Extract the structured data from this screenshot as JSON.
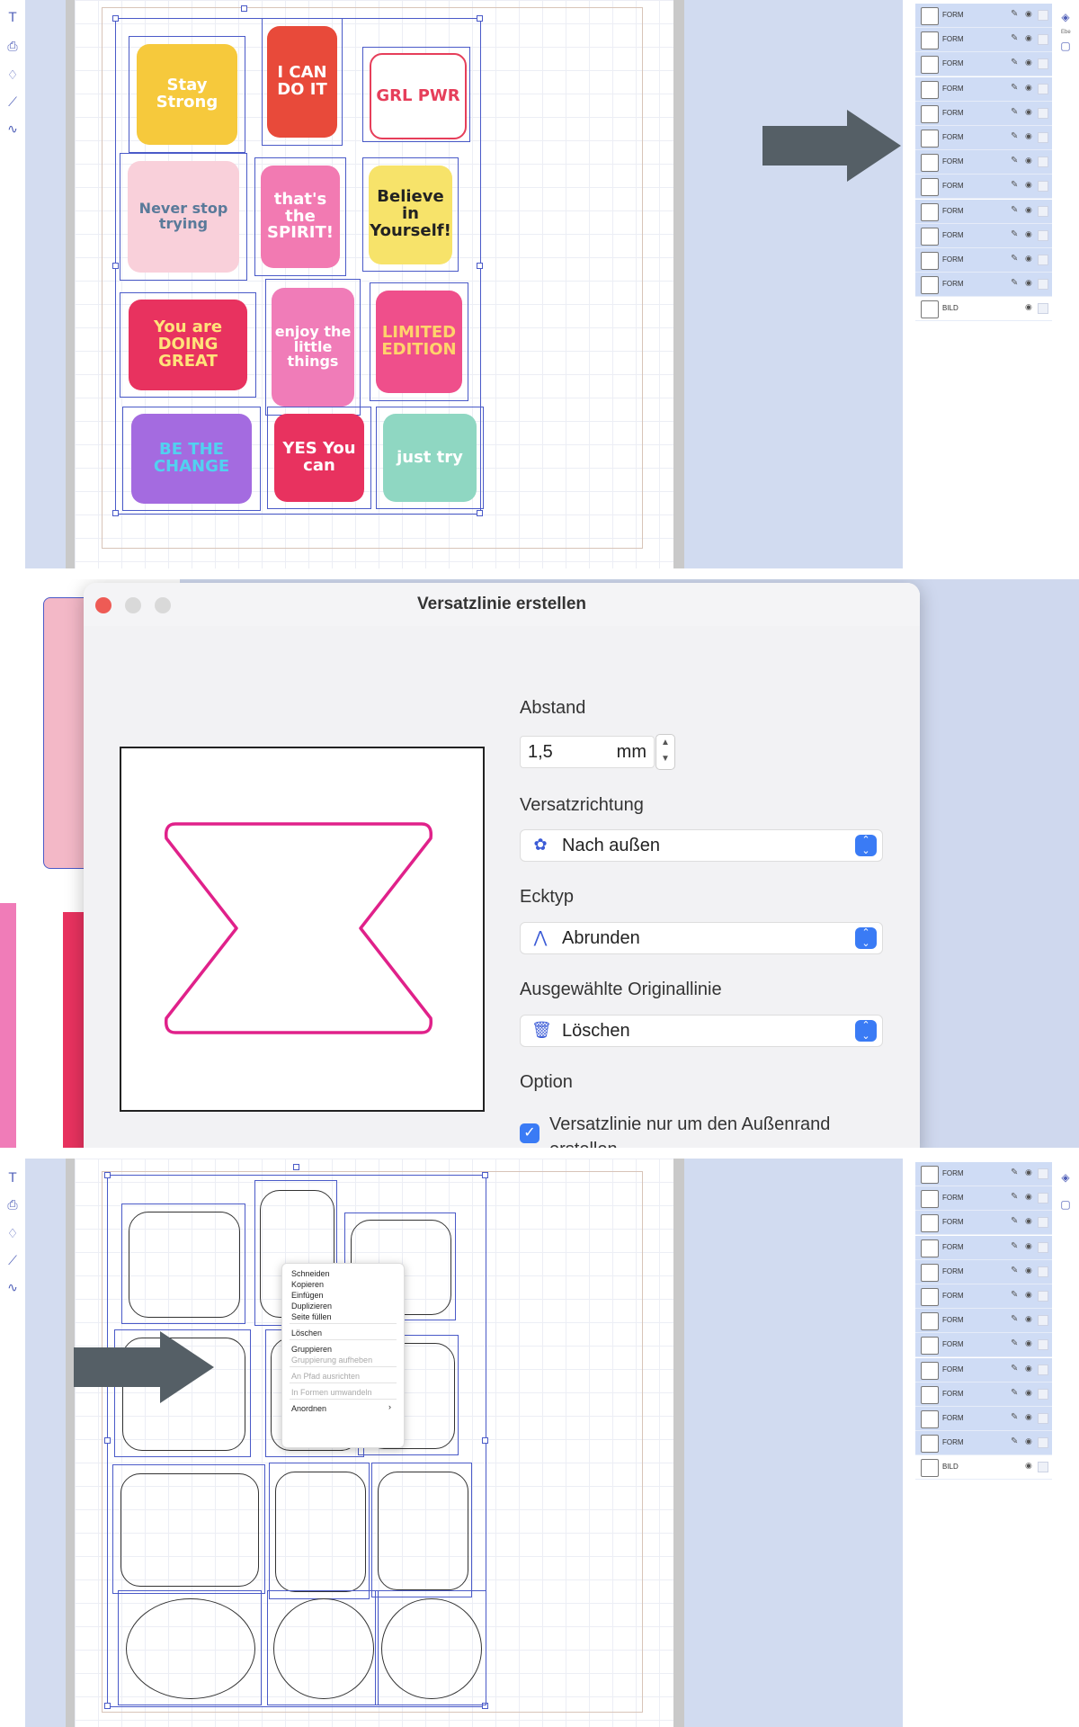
{
  "panel1": {
    "layers": [
      {
        "name": "FORM"
      },
      {
        "name": "FORM"
      },
      {
        "name": "FORM"
      },
      {
        "name": "FORM"
      },
      {
        "name": "FORM"
      },
      {
        "name": "FORM"
      },
      {
        "name": "FORM"
      },
      {
        "name": "FORM"
      },
      {
        "name": "FORM"
      },
      {
        "name": "FORM"
      },
      {
        "name": "FORM"
      },
      {
        "name": "FORM"
      },
      {
        "name": "BILD"
      }
    ],
    "side_label": "Ebe",
    "stickers": [
      {
        "text": "Stay Strong",
        "bg": "#f6c93c",
        "fg": "#ffffff"
      },
      {
        "text": "I CAN DO IT",
        "bg": "#e84a3a",
        "fg": "#ffffff"
      },
      {
        "text": "GRL PWR",
        "bg": "#ffffff",
        "fg": "#e63e5a"
      },
      {
        "text": "Never stop trying",
        "bg": "#f9d0da",
        "fg": "#5a7a9a"
      },
      {
        "text": "that's the SPIRIT!",
        "bg": "#f27ab2",
        "fg": "#ffffff"
      },
      {
        "text": "Believe in Yourself!",
        "bg": "#f7e36a",
        "fg": "#222222"
      },
      {
        "text": "You are DOING GREAT",
        "bg": "#e8325f",
        "fg": "#ffe37a"
      },
      {
        "text": "enjoy the little things",
        "bg": "#f07cb8",
        "fg": "#ffffff"
      },
      {
        "text": "LIMITED EDITION",
        "bg": "#ef4f8b",
        "fg": "#ffd36b"
      },
      {
        "text": "BE THE CHANGE",
        "bg": "#a46be0",
        "fg": "#52d1f0"
      },
      {
        "text": "YES You can",
        "bg": "#e8325f",
        "fg": "#ffffff"
      },
      {
        "text": "just try",
        "bg": "#8fd7c2",
        "fg": "#ffffff"
      }
    ]
  },
  "dialog": {
    "title": "Versatzlinie erstellen",
    "distance_label": "Abstand",
    "distance_value": "1,5",
    "distance_unit": "mm",
    "direction_label": "Versatzrichtung",
    "direction_value": "Nach außen",
    "corner_label": "Ecktyp",
    "corner_value": "Abrunden",
    "original_label": "Ausgewählte Originallinie",
    "original_value": "Löschen",
    "option_label": "Option",
    "option_checkbox": "Versatzlinie nur um den Außenrand erstellen",
    "option_checked": true,
    "preview_stroke": "#e0218a",
    "accent": "#3a7bf5"
  },
  "panel3": {
    "context_menu": [
      {
        "label": "Schneiden",
        "enabled": true
      },
      {
        "label": "Kopieren",
        "enabled": true
      },
      {
        "label": "Einfügen",
        "enabled": true
      },
      {
        "label": "Duplizieren",
        "enabled": true
      },
      {
        "label": "Seite füllen",
        "enabled": true
      },
      {
        "label": "Löschen",
        "enabled": true
      },
      {
        "label": "Gruppieren",
        "enabled": true
      },
      {
        "label": "Gruppierung aufheben",
        "enabled": false
      },
      {
        "label": "An Pfad ausrichten",
        "enabled": false
      },
      {
        "label": "In Formen umwandeln",
        "enabled": false
      },
      {
        "label": "Anordnen",
        "enabled": true
      }
    ],
    "layers": [
      {
        "name": "FORM"
      },
      {
        "name": "FORM"
      },
      {
        "name": "FORM"
      },
      {
        "name": "FORM"
      },
      {
        "name": "FORM"
      },
      {
        "name": "FORM"
      },
      {
        "name": "FORM"
      },
      {
        "name": "FORM"
      },
      {
        "name": "FORM"
      },
      {
        "name": "FORM"
      },
      {
        "name": "FORM"
      },
      {
        "name": "FORM"
      },
      {
        "name": "BILD"
      }
    ]
  },
  "icons": {
    "text_tool": "text-tool-icon",
    "print": "print-icon",
    "shape": "shape-icon",
    "line": "line-icon",
    "freehand": "freehand-icon",
    "layers": "layers-icon",
    "page": "page-icon",
    "arrow": "pointer-arrow"
  },
  "colors": {
    "arrow": "#555f66",
    "selection": "#4a5ac8",
    "layer_row": "#cfdcf5"
  }
}
